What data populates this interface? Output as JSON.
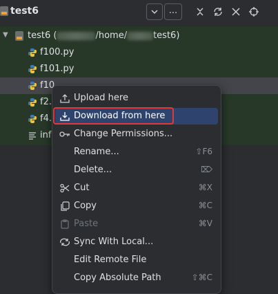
{
  "header": {
    "title": "test6",
    "buttons": [
      {
        "name": "dropdown-chevron-button",
        "glyph": "chevron-down-icon"
      },
      {
        "name": "more-options-button",
        "label": "..."
      },
      {
        "name": "collapse-all-button",
        "glyph": "collapse-icon"
      },
      {
        "name": "refresh-button",
        "glyph": "refresh-icon"
      },
      {
        "name": "close-button",
        "glyph": "close-icon"
      },
      {
        "name": "locate-button",
        "glyph": "target-icon"
      }
    ]
  },
  "tree": {
    "root": {
      "label_prefix": "test6 (",
      "path_mid": "/home/",
      "path_suffix": "test6)"
    },
    "items": [
      {
        "label": "f100.py",
        "type": "python"
      },
      {
        "label": "f101.py",
        "type": "python"
      },
      {
        "label": "f10",
        "type": "python",
        "selected": true
      },
      {
        "label": "f2.",
        "type": "python"
      },
      {
        "label": "f4.",
        "type": "python"
      },
      {
        "label": "inf",
        "type": "text"
      }
    ]
  },
  "menu": {
    "items": [
      {
        "label": "Upload here",
        "icon": "upload-icon",
        "shortcut": ""
      },
      {
        "label": "Download from here",
        "icon": "download-icon",
        "shortcut": "",
        "active": true
      },
      {
        "label": "Change Permissions...",
        "icon": "key-icon",
        "shortcut": ""
      },
      {
        "label": "Rename...",
        "icon": "",
        "shortcut": "⇧F6"
      },
      {
        "label": "Delete...",
        "icon": "",
        "shortcut": "⌦"
      },
      {
        "label": "Cut",
        "icon": "scissors-icon",
        "shortcut": "⌘X"
      },
      {
        "label": "Copy",
        "icon": "copy-icon",
        "shortcut": "⌘C"
      },
      {
        "label": "Paste",
        "icon": "paste-icon",
        "shortcut": "⌘V",
        "disabled": true
      },
      {
        "label": "Sync With Local...",
        "icon": "sync-icon",
        "shortcut": ""
      },
      {
        "label": "Edit Remote File",
        "icon": "",
        "shortcut": ""
      },
      {
        "label": "Copy Absolute Path",
        "icon": "",
        "shortcut": "⇧⌘C"
      }
    ]
  },
  "colors": {
    "background": "#2b2d30",
    "tree_background": "#273828",
    "menu_active": "#2e436e",
    "highlight_border": "#e03a3a"
  }
}
